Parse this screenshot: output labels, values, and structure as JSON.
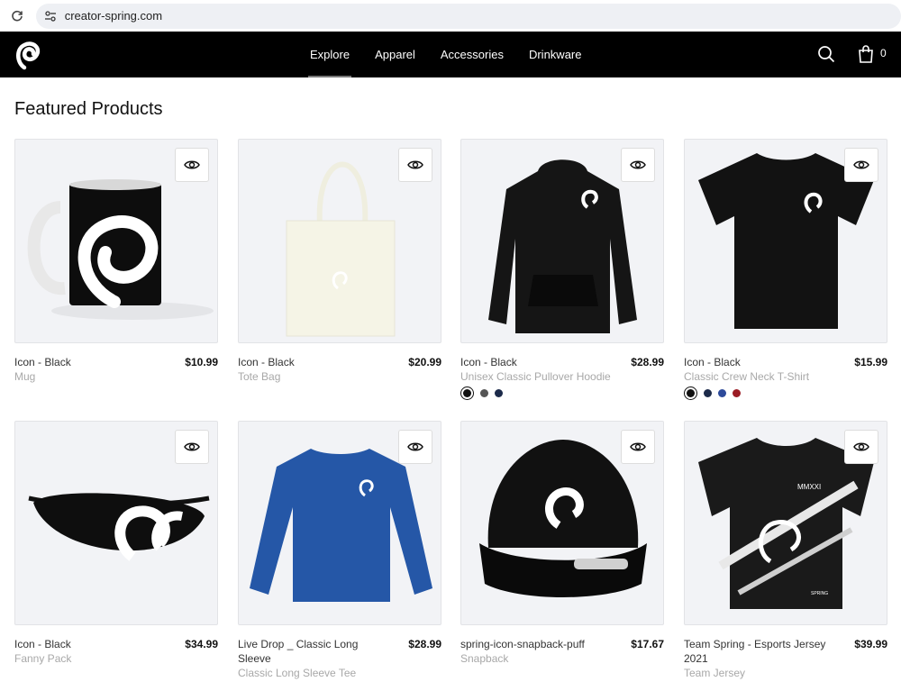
{
  "browser": {
    "url": "creator-spring.com"
  },
  "header": {
    "nav": [
      "Explore",
      "Apparel",
      "Accessories",
      "Drinkware"
    ],
    "cart_count": "0"
  },
  "main": {
    "title": "Featured Products",
    "products": [
      {
        "title": "Icon - Black",
        "type": "Mug",
        "price": "$10.99",
        "swatches": []
      },
      {
        "title": "Icon - Black",
        "type": "Tote Bag",
        "price": "$20.99",
        "swatches": []
      },
      {
        "title": "Icon - Black",
        "type": "Unisex Classic Pullover Hoodie",
        "price": "$28.99",
        "swatches": [
          "#111111",
          "#555555",
          "#1c2a4a"
        ]
      },
      {
        "title": "Icon - Black",
        "type": "Classic Crew Neck T-Shirt",
        "price": "$15.99",
        "swatches": [
          "#111111",
          "#1c2a4a",
          "#2d4a9a",
          "#9b1c24"
        ]
      },
      {
        "title": "Icon - Black",
        "type": "Fanny Pack",
        "price": "$34.99",
        "swatches": []
      },
      {
        "title": "Live Drop _ Classic Long Sleeve",
        "type": "Classic Long Sleeve Tee",
        "price": "$28.99",
        "swatches": []
      },
      {
        "title": "spring-icon-snapback-puff",
        "type": "Snapback",
        "price": "$17.67",
        "swatches": []
      },
      {
        "title": "Team Spring - Esports Jersey 2021",
        "type": "Team Jersey",
        "price": "$39.99",
        "swatches": []
      }
    ]
  },
  "jersey_text": "MMXXI",
  "jersey_brand": "SPRING",
  "icons": {
    "reload": "reload-icon",
    "site": "site-settings-icon",
    "logo": "spring-logo",
    "search": "search-icon",
    "bag": "shopping-bag-icon",
    "quick_view": "eye-icon"
  }
}
